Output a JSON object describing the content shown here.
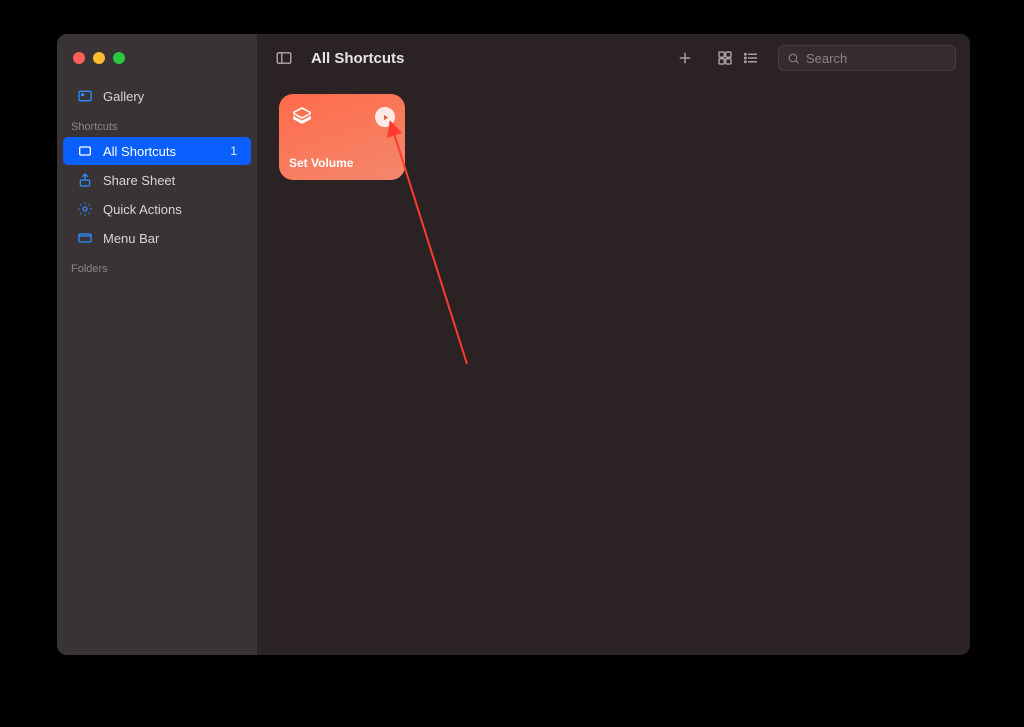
{
  "window": {
    "title": "All Shortcuts"
  },
  "sidebar": {
    "gallery_label": "Gallery",
    "section1_label": "Shortcuts",
    "items": [
      {
        "label": "All Shortcuts",
        "count": "1",
        "selected": true
      },
      {
        "label": "Share Sheet"
      },
      {
        "label": "Quick Actions"
      },
      {
        "label": "Menu Bar"
      }
    ],
    "section2_label": "Folders"
  },
  "toolbar": {
    "search_placeholder": "Search"
  },
  "shortcuts": [
    {
      "title": "Set Volume"
    }
  ]
}
